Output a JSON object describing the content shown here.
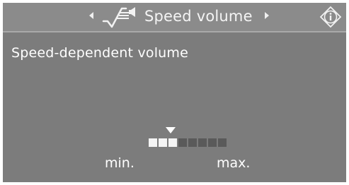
{
  "header": {
    "title": "Speed volume",
    "mode_icon": "speed-volume-icon",
    "info_icon": "info-icon"
  },
  "content": {
    "setting_label": "Speed-dependent volume",
    "scale": {
      "segments": 8,
      "level": 3,
      "min_label": "min.",
      "max_label": "max."
    }
  },
  "colors": {
    "background": "#7c7c7c",
    "header": "#8b8b8b",
    "text": "#ffffff",
    "segment_on": "#f4f4f4",
    "segment_off": "#5a5a5a"
  }
}
